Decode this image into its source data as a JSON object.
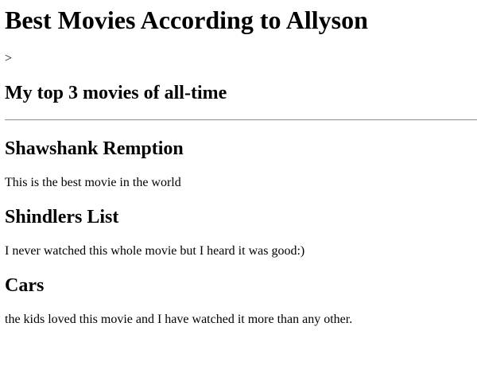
{
  "page": {
    "title": "Best Movies According to Allyson",
    "stray_text": ">",
    "subtitle": "My top 3 movies of all-time"
  },
  "movies": [
    {
      "title": "Shawshank Remption",
      "description": "This is the best movie in the world"
    },
    {
      "title": "Shindlers List",
      "description": "I never watched this whole movie but I heard it was good:)"
    },
    {
      "title": "Cars",
      "description": "the kids loved this movie and I have watched it more than any other."
    }
  ]
}
